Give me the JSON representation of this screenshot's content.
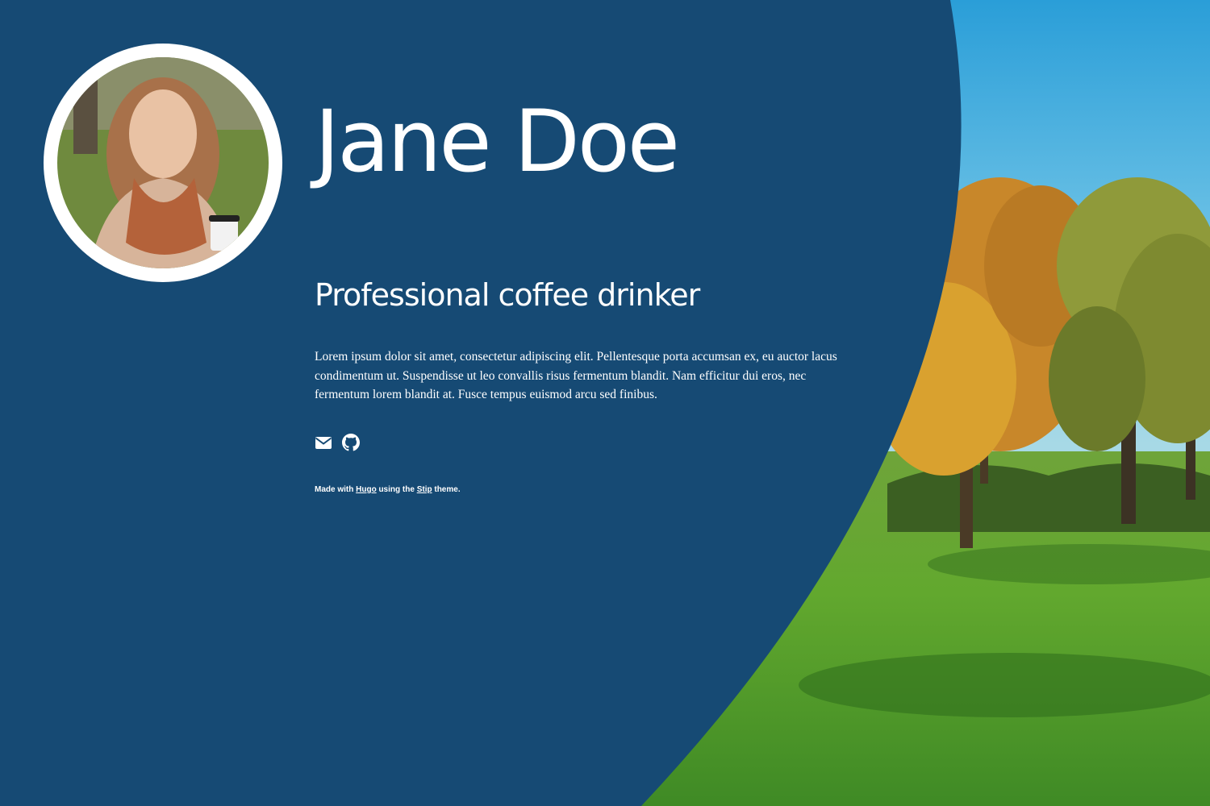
{
  "profile": {
    "name": "Jane Doe",
    "tagline": "Professional coffee drinker",
    "bio": "Lorem ipsum dolor sit amet, consectetur adipiscing elit. Pellentesque porta accumsan ex, eu auctor lacus condimentum ut. Suspendisse ut leo convallis risus fermentum blandit. Nam efficitur dui eros, nec fermentum lorem blandit at. Fusce tempus euismod arcu sed finibus."
  },
  "social": [
    {
      "icon": "envelope-icon"
    },
    {
      "icon": "github-icon"
    }
  ],
  "footer": {
    "made_with": "Made with",
    "hugo_link": "Hugo",
    "using_the": "using the",
    "theme_link": "Stip",
    "theme_suffix": "theme."
  },
  "colors": {
    "panel": "#164a74",
    "text": "#ffffff",
    "sky": "#5ab8e0",
    "grass": "#4e9a2a",
    "foliage": "#d79a24"
  }
}
